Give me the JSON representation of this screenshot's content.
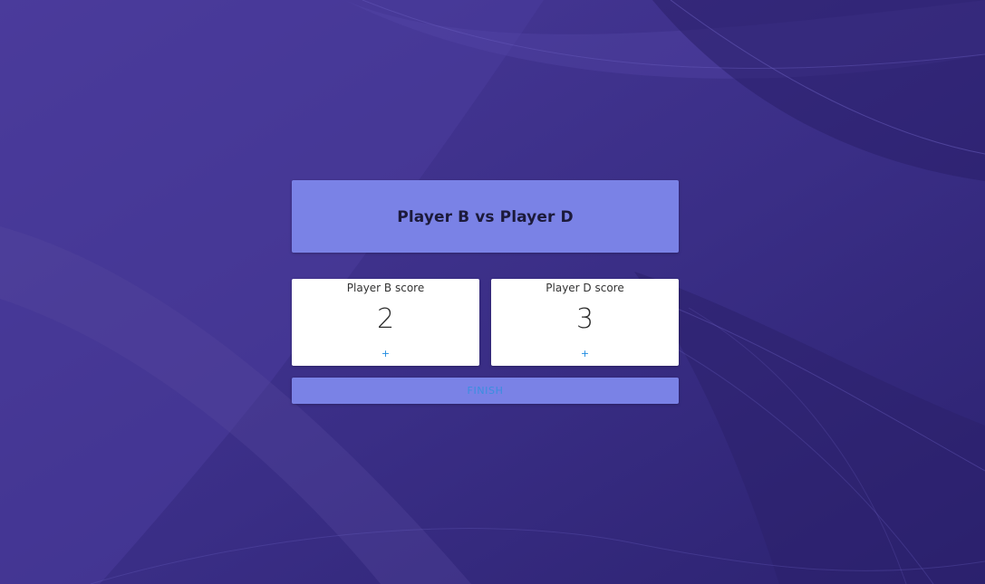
{
  "colors": {
    "background": "#34287a",
    "header_panel": "#7a82e6",
    "card": "#ffffff",
    "accent_text": "#1e8be0"
  },
  "match": {
    "title": "Player B vs Player D"
  },
  "scores": [
    {
      "label": "Player B score",
      "value": "2",
      "increment_label": "+"
    },
    {
      "label": "Player D score",
      "value": "3",
      "increment_label": "+"
    }
  ],
  "actions": {
    "finish_label": "FINISH"
  }
}
